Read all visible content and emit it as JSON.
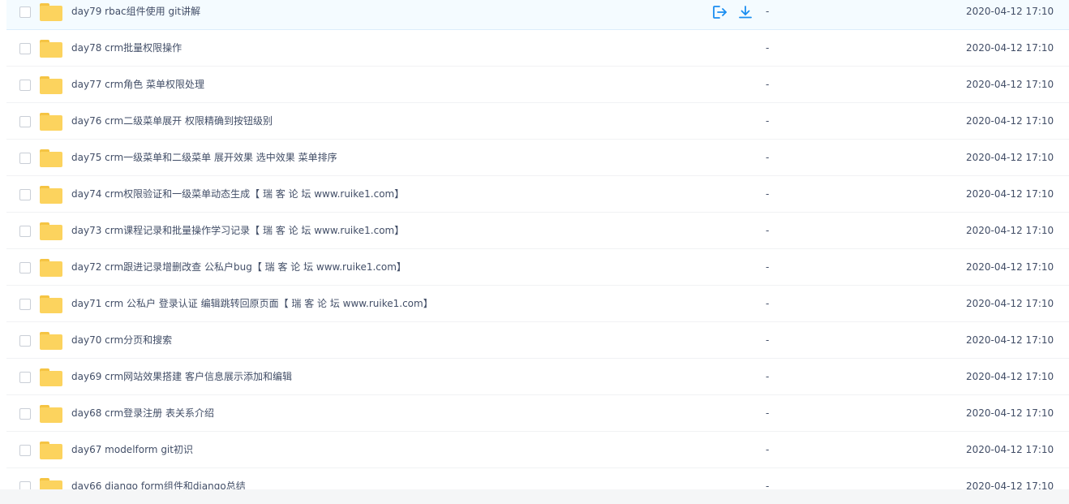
{
  "file_list": {
    "rows": [
      {
        "name": "day79 rbac组件使用 git讲解",
        "size": "-",
        "date": "2020-04-12 17:10"
      },
      {
        "name": "day78 crm批量权限操作",
        "size": "-",
        "date": "2020-04-12 17:10"
      },
      {
        "name": "day77 crm角色 菜单权限处理",
        "size": "-",
        "date": "2020-04-12 17:10"
      },
      {
        "name": "day76 crm二级菜单展开 权限精确到按钮级别",
        "size": "-",
        "date": "2020-04-12 17:10"
      },
      {
        "name": "day75 crm一级菜单和二级菜单 展开效果 选中效果 菜单排序",
        "size": "-",
        "date": "2020-04-12 17:10"
      },
      {
        "name": "day74 crm权限验证和一级菜单动态生成【 瑞 客 论 坛 www.ruike1.com】",
        "size": "-",
        "date": "2020-04-12 17:10"
      },
      {
        "name": "day73 crm课程记录和批量操作学习记录【 瑞 客 论 坛 www.ruike1.com】",
        "size": "-",
        "date": "2020-04-12 17:10"
      },
      {
        "name": "day72 crm跟进记录增删改查 公私户bug【 瑞 客 论 坛 www.ruike1.com】",
        "size": "-",
        "date": "2020-04-12 17:10"
      },
      {
        "name": "day71 crm 公私户 登录认证 编辑跳转回原页面【 瑞 客 论 坛 www.ruike1.com】",
        "size": "-",
        "date": "2020-04-12 17:10"
      },
      {
        "name": "day70 crm分页和搜索",
        "size": "-",
        "date": "2020-04-12 17:10"
      },
      {
        "name": "day69 crm网站效果搭建 客户信息展示添加和编辑",
        "size": "-",
        "date": "2020-04-12 17:10"
      },
      {
        "name": "day68 crm登录注册 表关系介绍",
        "size": "-",
        "date": "2020-04-12 17:10"
      },
      {
        "name": "day67 modelform git初识",
        "size": "-",
        "date": "2020-04-12 17:10"
      },
      {
        "name": "day66 django form组件和django总结",
        "size": "-",
        "date": "2020-04-12 17:10"
      }
    ],
    "hovered_row_icons": [
      "share-icon",
      "download-icon"
    ]
  },
  "colors": {
    "accent": "#1a8df0",
    "folder": "#fcd35e",
    "text": "#424e67",
    "hover_bg": "#f4fbff"
  }
}
